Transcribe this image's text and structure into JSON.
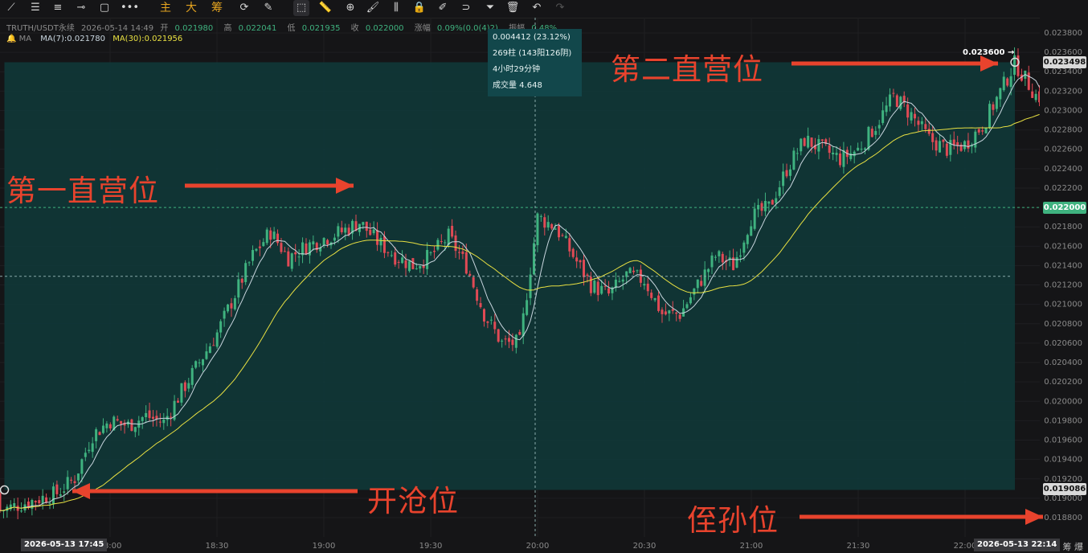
{
  "toolbar": {
    "items": [
      {
        "name": "trend-line-icon",
        "glyph": "⟋"
      },
      {
        "name": "horizontal-lines-icon",
        "glyph": "☰"
      },
      {
        "name": "parallel-lines-icon",
        "glyph": "≡"
      },
      {
        "name": "ray-icon",
        "glyph": "⊸"
      },
      {
        "name": "rectangle-icon",
        "glyph": "▢"
      },
      {
        "name": "more-dots-icon",
        "glyph": "•••"
      },
      {
        "name": "main-chart-button",
        "label": "主"
      },
      {
        "name": "large-button",
        "label": "大"
      },
      {
        "name": "chips-button",
        "label": "筹"
      },
      {
        "name": "cycle-icon",
        "glyph": "⟳"
      },
      {
        "name": "pencil-icon",
        "glyph": "✎"
      },
      {
        "name": "cursor-select-icon",
        "glyph": "⬚"
      },
      {
        "name": "ruler-icon",
        "glyph": "📏"
      },
      {
        "name": "zoom-icon",
        "glyph": "⊕"
      },
      {
        "name": "brush-icon",
        "glyph": "🖌"
      },
      {
        "name": "candle-icon",
        "glyph": "⫼"
      },
      {
        "name": "lock-icon",
        "glyph": "🔒"
      },
      {
        "name": "edit-icon",
        "glyph": "✐"
      },
      {
        "name": "magnet-icon",
        "glyph": "⊃"
      },
      {
        "name": "filter-icon",
        "glyph": "⏷"
      },
      {
        "name": "trash-icon",
        "glyph": "🗑"
      },
      {
        "name": "undo-icon",
        "glyph": "↶"
      },
      {
        "name": "redo-icon",
        "glyph": "↷"
      }
    ]
  },
  "info": {
    "symbol": "TRUTH/USDT永续",
    "datetime": "2026-05-14 14:49",
    "open_label": "开",
    "open": "0.021980",
    "high_label": "高",
    "high": "0.022041",
    "low_label": "低",
    "low": "0.021935",
    "close_label": "收",
    "close": "0.022000",
    "change_label": "涨幅",
    "change": "0.09%(0.0(4)2)",
    "amplitude_label": "振幅",
    "amplitude": "0.48%"
  },
  "ma": {
    "label": "MA",
    "ma7": "MA(7):0.021780",
    "ma30": "MA(30):0.021956"
  },
  "tooltip": {
    "line1": "0.004412 (23.12%)",
    "line2": "269柱 (143阳126阴)",
    "line3": "4小时29分钟",
    "line4": "成交量 4.648"
  },
  "annotations": {
    "first": "第一直营位",
    "second": "第二直营位",
    "open": "开沧位",
    "stop": "侄孙位",
    "target_label": "0.023600"
  },
  "price_boxes": {
    "high": "0.023498",
    "current": "0.022000",
    "low": "0.019086"
  },
  "time_boxes": {
    "start": "2026-05-13 17:45",
    "end": "2026-05-13 22:14"
  },
  "corner": "筹 爆",
  "colors": {
    "up": "#3fb27f",
    "down": "#e04a55",
    "ma7": "#c9d6df",
    "ma30": "#e8e042",
    "range_fill": "#0f3a3a",
    "annotation": "#e8432d"
  },
  "chart_data": {
    "type": "candlestick",
    "y_ticks": [
      "0.023800",
      "0.023600",
      "0.023400",
      "0.023200",
      "0.023000",
      "0.022800",
      "0.022600",
      "0.022400",
      "0.022200",
      "0.022000",
      "0.021800",
      "0.021600",
      "0.021400",
      "0.021200",
      "0.021000",
      "0.020800",
      "0.020600",
      "0.020400",
      "0.020200",
      "0.020000",
      "0.019800",
      "0.019600",
      "0.019400",
      "0.019200",
      "0.019000",
      "0.018800"
    ],
    "ylim": [
      0.01872,
      0.02394
    ],
    "x_ticks": [
      "18:00",
      "18:30",
      "19:00",
      "19:30",
      "20:00",
      "20:30",
      "21:00",
      "21:30",
      "22:00"
    ],
    "close_path": [
      [
        "17:45",
        0.01905
      ],
      [
        "17:50",
        0.0192
      ],
      [
        "17:55",
        0.01965
      ],
      [
        "18:00",
        0.0198
      ],
      [
        "18:05",
        0.01975
      ],
      [
        "18:10",
        0.01985
      ],
      [
        "18:15",
        0.01978
      ],
      [
        "18:20",
        0.0201
      ],
      [
        "18:25",
        0.0204
      ],
      [
        "18:30",
        0.0207
      ],
      [
        "18:35",
        0.0211
      ],
      [
        "18:40",
        0.0215
      ],
      [
        "18:45",
        0.02175
      ],
      [
        "18:50",
        0.02148
      ],
      [
        "18:55",
        0.0216
      ],
      [
        "19:00",
        0.02168
      ],
      [
        "19:05",
        0.02175
      ],
      [
        "19:10",
        0.02185
      ],
      [
        "19:15",
        0.02165
      ],
      [
        "19:20",
        0.0215
      ],
      [
        "19:25",
        0.0214
      ],
      [
        "19:30",
        0.0215
      ],
      [
        "19:35",
        0.0217
      ],
      [
        "19:40",
        0.0214
      ],
      [
        "19:45",
        0.0209
      ],
      [
        "19:50",
        0.0206
      ],
      [
        "19:55",
        0.0206
      ],
      [
        "20:00",
        0.0219
      ],
      [
        "20:05",
        0.0218
      ],
      [
        "20:10",
        0.0215
      ],
      [
        "20:15",
        0.0212
      ],
      [
        "20:20",
        0.0211
      ],
      [
        "20:25",
        0.0213
      ],
      [
        "20:30",
        0.02125
      ],
      [
        "20:35",
        0.0209
      ],
      [
        "20:40",
        0.0209
      ],
      [
        "20:45",
        0.0212
      ],
      [
        "20:50",
        0.0215
      ],
      [
        "20:55",
        0.0214
      ],
      [
        "21:00",
        0.0219
      ],
      [
        "21:05",
        0.022
      ],
      [
        "21:10",
        0.0224
      ],
      [
        "21:15",
        0.0227
      ],
      [
        "21:20",
        0.0226
      ],
      [
        "21:25",
        0.0225
      ],
      [
        "21:30",
        0.0226
      ],
      [
        "21:35",
        0.02285
      ],
      [
        "21:40",
        0.02315
      ],
      [
        "21:45",
        0.02295
      ],
      [
        "21:50",
        0.0227
      ],
      [
        "21:55",
        0.0226
      ],
      [
        "22:00",
        0.02265
      ],
      [
        "22:05",
        0.02285
      ],
      [
        "22:10",
        0.0232
      ],
      [
        "22:14",
        0.02349
      ],
      [
        "22:20",
        0.02315
      ],
      [
        "22:25",
        0.0231
      ]
    ],
    "range_box": {
      "price_high": 0.023498,
      "price_low": 0.019086,
      "time_start": "17:45",
      "time_end": "22:14"
    },
    "current_price": 0.022,
    "midline_price": 0.02129,
    "target_price": 0.0236,
    "stop_price": 0.0188
  }
}
